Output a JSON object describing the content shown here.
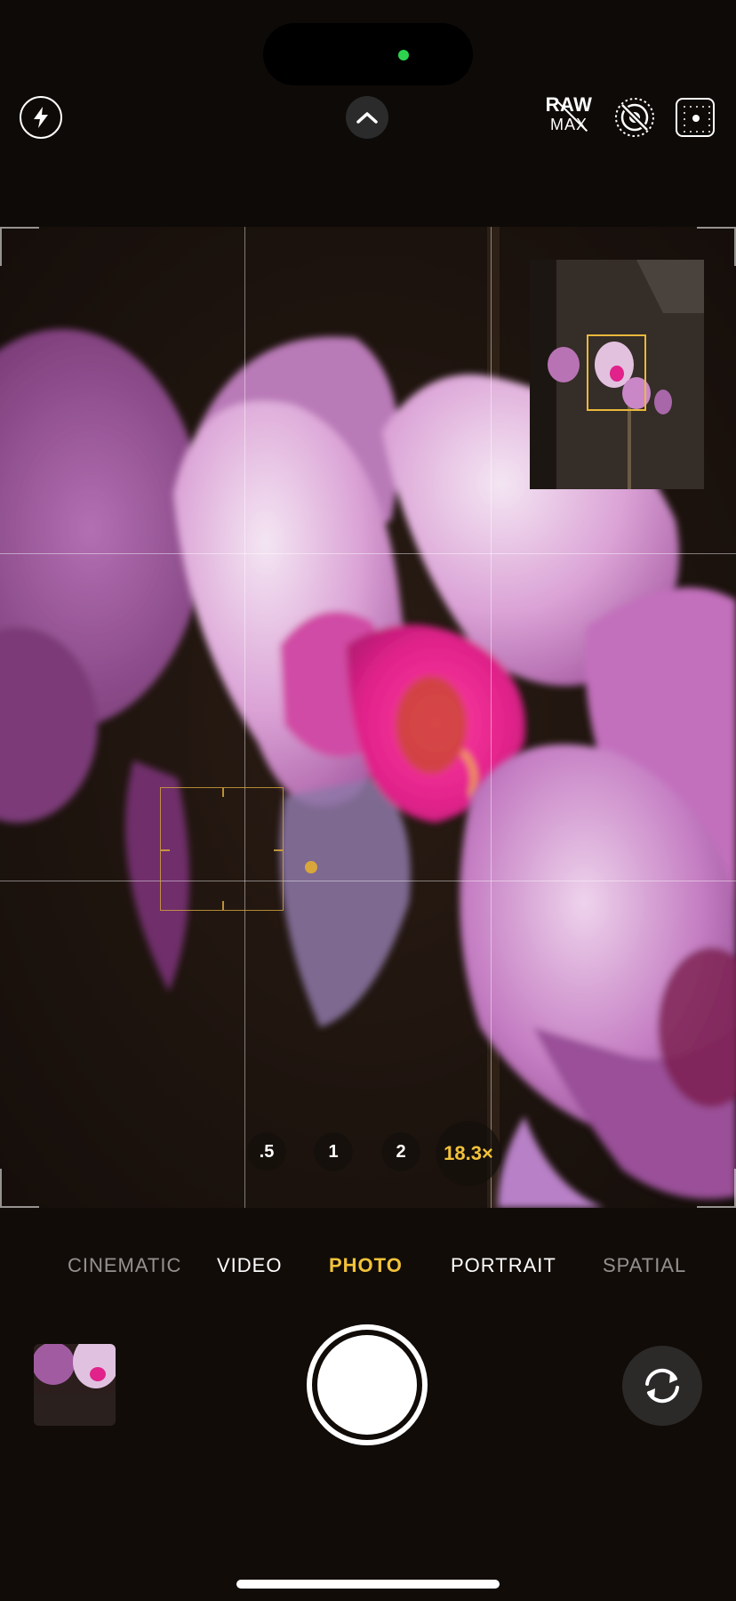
{
  "status": {
    "privacy_indicator_color": "#2dd24e"
  },
  "top_controls": {
    "flash_icon": "lightning-bolt-icon",
    "expand_icon": "chevron-up-icon",
    "raw_max": {
      "line1": "RAW",
      "line2": "MAX",
      "state": "off"
    },
    "live_photo_icon": "live-photo-off-icon",
    "grid_toggle_icon": "grid-dots-icon"
  },
  "viewfinder": {
    "accent_color": "#f2c23a",
    "focus_color": "#d9a63c"
  },
  "zoom": {
    "options": [
      ".5",
      "1",
      "2"
    ],
    "active": "18.3×"
  },
  "modes": {
    "items": [
      "CINEMATIC",
      "VIDEO",
      "PHOTO",
      "PORTRAIT",
      "SPATIAL"
    ],
    "active": "PHOTO"
  },
  "bottom_controls": {
    "shutter_icon": "shutter-button",
    "flip_icon": "camera-flip-icon",
    "thumbnail_icon": "last-photo-thumbnail"
  }
}
